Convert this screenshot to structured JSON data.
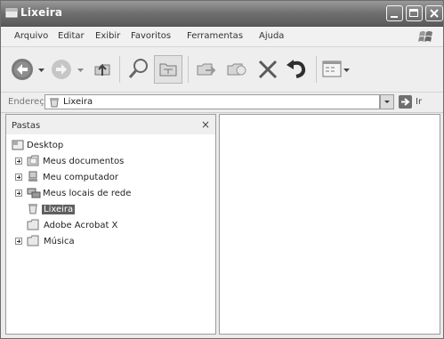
{
  "window": {
    "title": "Lixeira"
  },
  "menu": {
    "items": [
      {
        "id": "arquivo",
        "label": "Arquivo"
      },
      {
        "id": "editar",
        "label": "Editar"
      },
      {
        "id": "exibir",
        "label": "Exibir"
      },
      {
        "id": "favoritos",
        "label": "Favoritos"
      },
      {
        "id": "ferramentas",
        "label": "Ferramentas"
      },
      {
        "id": "ajuda",
        "label": "Ajuda"
      }
    ]
  },
  "address": {
    "label": "Endereço",
    "value": "Lixeira",
    "go_label": "Ir"
  },
  "folders": {
    "title": "Pastas",
    "close_label": "×",
    "tree": [
      {
        "label": "Desktop"
      },
      {
        "label": "Meus documentos"
      },
      {
        "label": "Meu computador"
      },
      {
        "label": "Meus locais de rede"
      },
      {
        "label": "Lixeira"
      },
      {
        "label": "Adobe Acrobat X"
      },
      {
        "label": "Música"
      }
    ]
  }
}
